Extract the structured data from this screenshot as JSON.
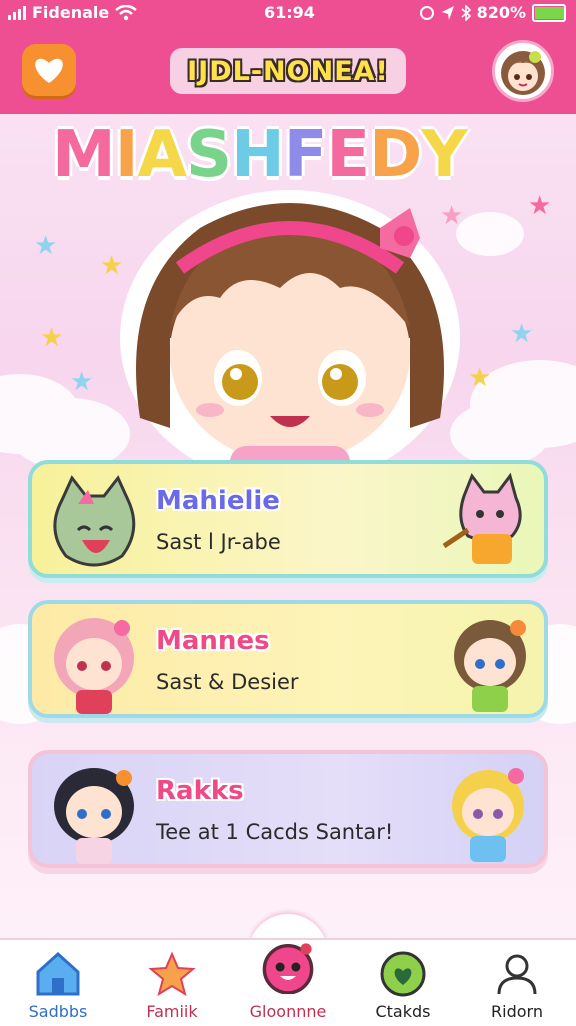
{
  "status": {
    "carrier": "Fidenale",
    "time": "61:94",
    "battery_pct": "820%",
    "battery_level": 0.95
  },
  "header": {
    "title": "IJDL-NONEA!",
    "heart_icon": "heart-icon",
    "avatar_icon": "girl-avatar-icon"
  },
  "hero": {
    "title": "MIASHFEDY",
    "title_colors": [
      "#f56a9e",
      "#f8a24a",
      "#f5d84a",
      "#79d38a",
      "#6ecbe6",
      "#8f8be8"
    ]
  },
  "cards": [
    {
      "name": "Mahielie",
      "subtitle": "Sast l Jr-abe"
    },
    {
      "name": "Mannes",
      "subtitle": "Sast & Desier"
    },
    {
      "name": "Rakks",
      "subtitle": "Tee at 1 Cacds Santar!"
    }
  ],
  "tabs": [
    {
      "label": "Sadbbs",
      "icon": "home-icon",
      "color": "#2f6fc9"
    },
    {
      "label": "Famiik",
      "icon": "star-icon",
      "color": "#c0304f"
    },
    {
      "label": "Gloonnne",
      "icon": "character-face-icon",
      "color": "#c0304f"
    },
    {
      "label": "Ctakds",
      "icon": "heart-circle-icon",
      "color": "#222"
    },
    {
      "label": "Ridorn",
      "icon": "profile-icon",
      "color": "#222"
    }
  ],
  "colors": {
    "accent": "#ee4f92",
    "orange": "#f7902e"
  }
}
